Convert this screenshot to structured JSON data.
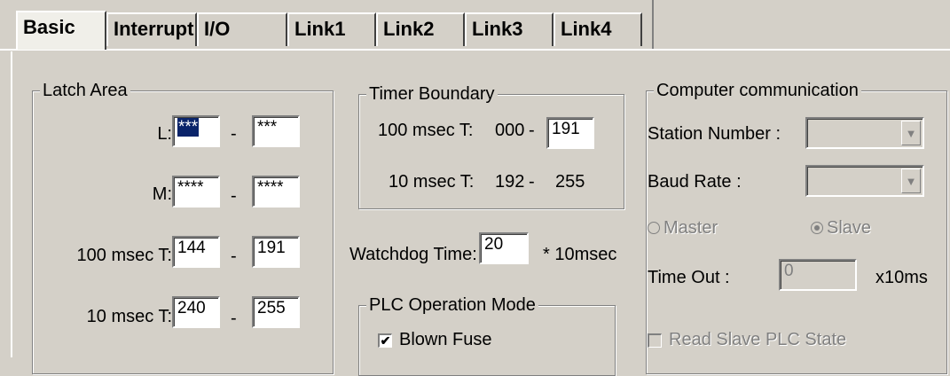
{
  "tabs": [
    "Basic",
    "Interrupt",
    "I/O",
    "Link1",
    "Link2",
    "Link3",
    "Link4"
  ],
  "latch": {
    "title": "Latch Area",
    "rows": [
      {
        "label": "L:",
        "from": "***",
        "to": "***"
      },
      {
        "label": "M:",
        "from": "****",
        "to": "****"
      },
      {
        "label": "100 msec T:",
        "from": "144",
        "to": "191"
      },
      {
        "label": "10 msec T:",
        "from": "240",
        "to": "255"
      }
    ],
    "dash": "-"
  },
  "timer": {
    "title": "Timer Boundary",
    "row1_label": "100 msec T:",
    "row1_start": "000",
    "row1_end": "191",
    "row2_label": "10 msec T:",
    "row2_start": "192",
    "row2_end": "255",
    "dash": "-"
  },
  "watchdog": {
    "label": "Watchdog Time:",
    "value": "20",
    "unit": "* 10msec"
  },
  "plc": {
    "title": "PLC Operation Mode",
    "blown_fuse": "Blown Fuse",
    "blown_fuse_checked": true
  },
  "comm": {
    "title": "Computer communication",
    "station_label": "Station Number :",
    "baud_label": "Baud Rate :",
    "master": "Master",
    "slave": "Slave",
    "timeout_label": "Time Out :",
    "timeout_value": "0",
    "timeout_unit": "x10ms",
    "read_slave": "Read Slave PLC State"
  }
}
